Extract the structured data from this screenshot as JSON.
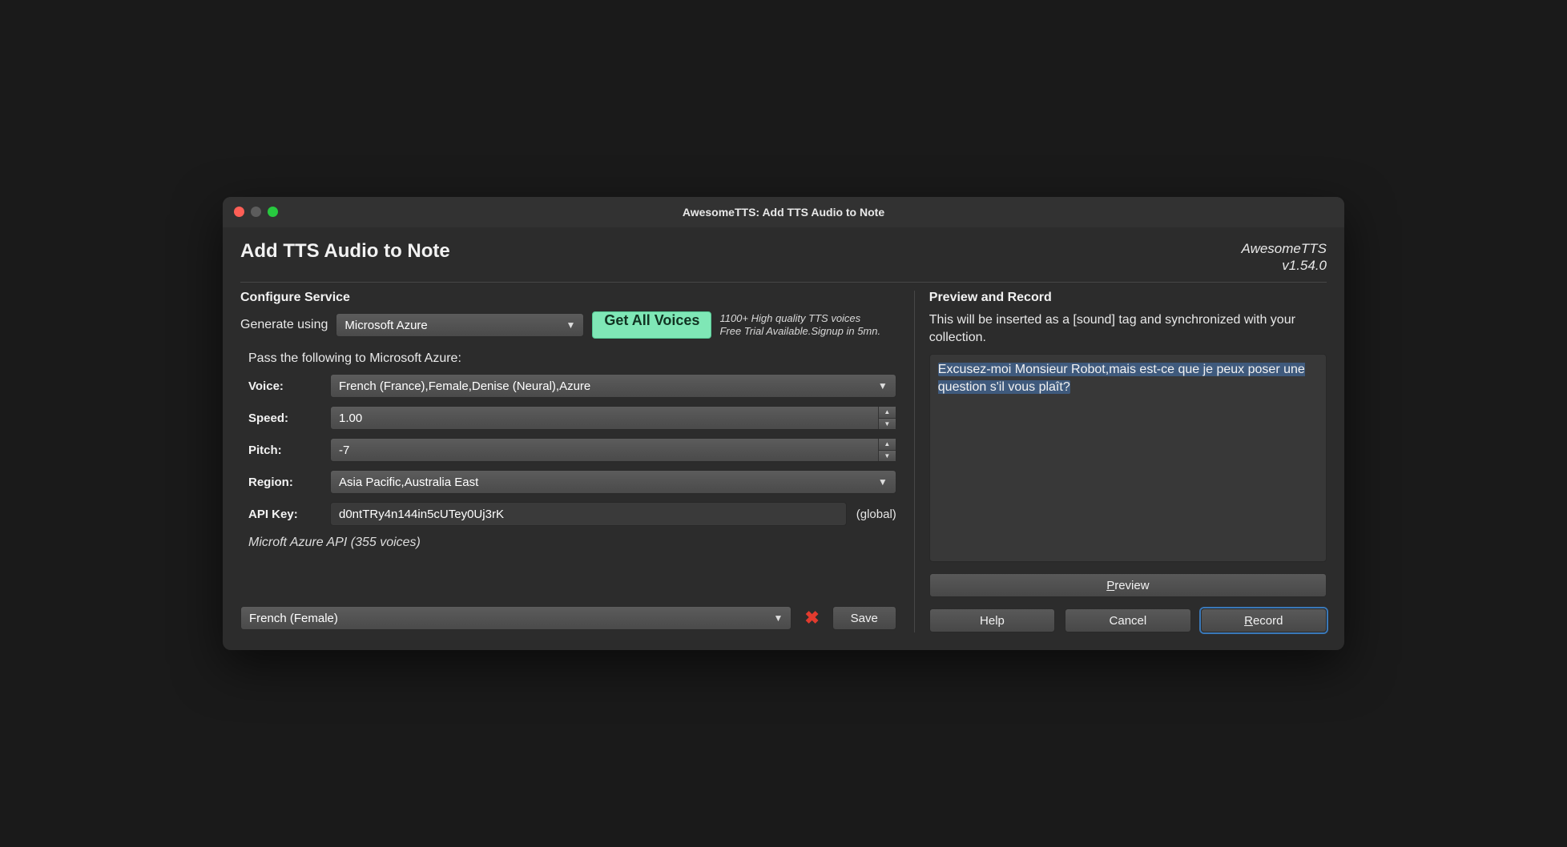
{
  "window": {
    "title": "AwesomeTTS: Add TTS Audio to Note"
  },
  "app": {
    "name": "AwesomeTTS",
    "version": "v1.54.0"
  },
  "page": {
    "title": "Add TTS Audio to Note"
  },
  "left": {
    "configure_title": "Configure Service",
    "generate_label": "Generate using",
    "service": "Microsoft Azure",
    "get_voices_label": "Get All Voices",
    "promo_line1": "1100+ High quality TTS voices",
    "promo_line2": "Free Trial Available.Signup in 5mn.",
    "pass_label": "Pass the following to Microsoft Azure:",
    "fields": {
      "voice_label": "Voice:",
      "voice_value": "French (France),Female,Denise (Neural),Azure",
      "speed_label": "Speed:",
      "speed_value": "1.00",
      "pitch_label": "Pitch:",
      "pitch_value": "-7",
      "region_label": "Region:",
      "region_value": "Asia Pacific,Australia East",
      "apikey_label": "API Key:",
      "apikey_value": "d0ntTRy4n144in5cUTey0Uj3rK",
      "apikey_scope": "(global)"
    },
    "service_desc": "Microft Azure API (355 voices)",
    "preset_value": "French (Female)",
    "save_label": "Save"
  },
  "right": {
    "title": "Preview and Record",
    "desc": "This will be inserted as a [sound] tag and synchronized with your collection.",
    "text": "Excusez-moi Monsieur Robot,mais est-ce que je peux poser une question s'il vous plaît?",
    "preview_label": "Preview",
    "help_label": "Help",
    "cancel_label": "Cancel",
    "record_label": "Record"
  }
}
